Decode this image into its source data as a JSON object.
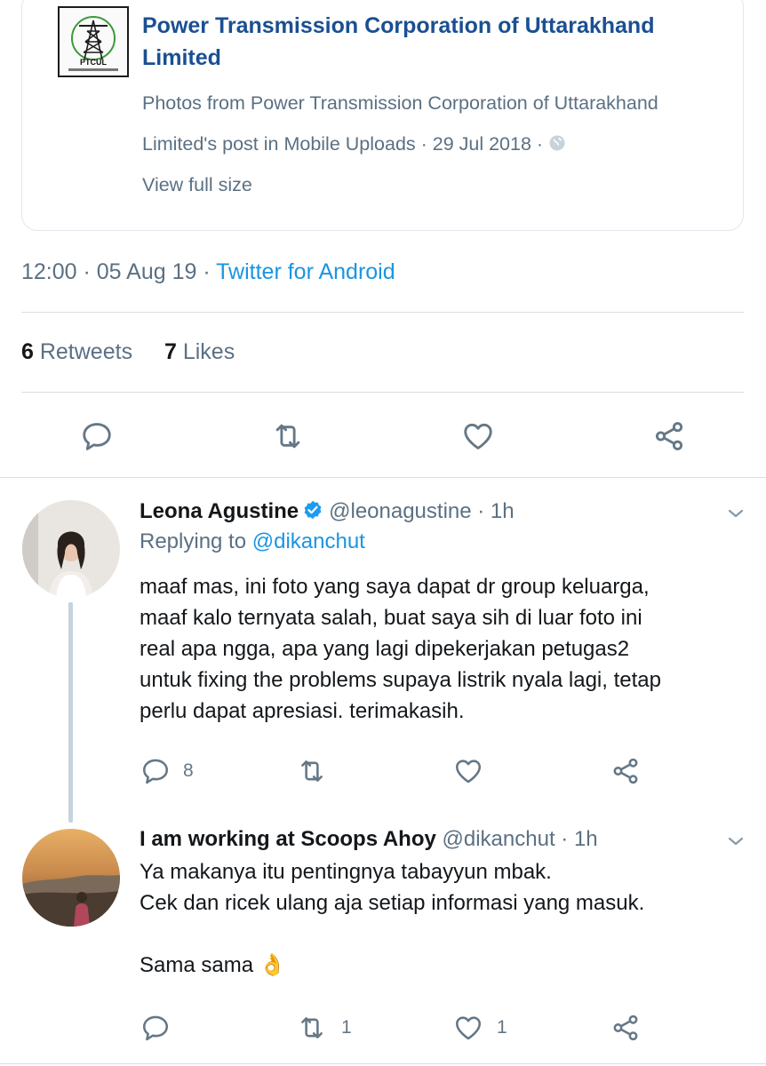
{
  "card": {
    "logo_text": "PTCUL",
    "title_line1": "Power Transmission Corporation of Uttarakhand",
    "title_line2": "Limited",
    "desc_line1": "Photos from Power Transmission Corporation of Uttarakhand",
    "desc_line2": "Limited's post in Mobile Uploads · 29 Jul 2018 ·",
    "link": "View full size"
  },
  "tweet": {
    "time": "12:00 · 05 Aug 19 · ",
    "client": "Twitter for Android",
    "retweet_count": "6",
    "retweet_label": " Retweets",
    "like_count": "7",
    "like_label": " Likes"
  },
  "replies": [
    {
      "name": "Leona Agustine",
      "handle": "@leonagustine · 1h",
      "verified": true,
      "replying_label": "Replying to ",
      "replying_to": "@dikanchut",
      "lines": [
        "maaf mas, ini foto yang saya dapat dr group keluarga,",
        "maaf kalo ternyata salah, buat saya sih di luar foto ini",
        "real apa ngga, apa yang lagi dipekerjakan petugas2",
        "untuk fixing the problems supaya listrik nyala lagi, tetap",
        "perlu dapat apresiasi. terimakasih."
      ],
      "reply_count": "8",
      "retweet_count": "",
      "like_count": ""
    },
    {
      "name": "I am working at Scoops Ahoy",
      "handle": "@dikanchut · 1h",
      "lines": [
        "Ya makanya itu pentingnya tabayyun mbak.",
        "Cek dan ricek ulang aja setiap informasi yang masuk."
      ],
      "last_line": "Sama sama",
      "emoji": "👌",
      "reply_count": "",
      "retweet_count": "1",
      "like_count": "1"
    }
  ],
  "icons": {
    "reply": "reply-icon",
    "retweet": "retweet-icon",
    "like": "heart-icon",
    "share": "share-icon",
    "more": "chevron-down-icon",
    "verified": "verified-badge-icon",
    "globe": "globe-icon"
  },
  "colors": {
    "link_blue": "#1b95e0",
    "card_title": "#1b4f91",
    "secondary_text": "#5b7083",
    "icon_gray": "#657786",
    "divider": "#d8dee3",
    "thread_line": "#c6d3dd"
  }
}
